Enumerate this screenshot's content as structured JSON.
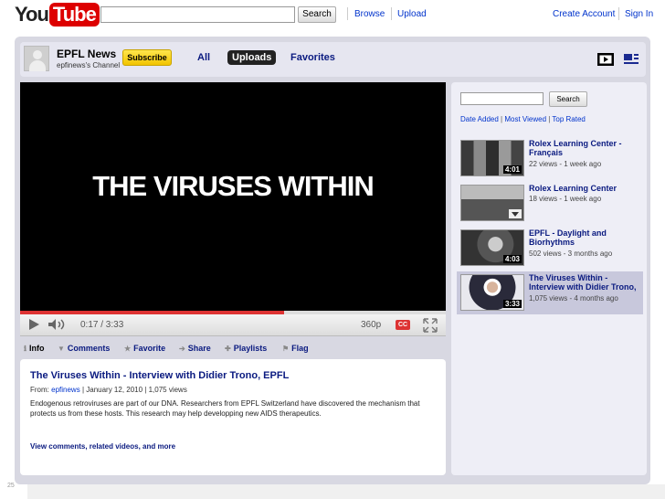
{
  "colors": {
    "brand_red": "#dd0000",
    "link_blue": "#0033cc",
    "subscribe_yellow": "#f2c400",
    "frame_gray": "#d8d8e2"
  },
  "header": {
    "logo_you": "You",
    "logo_tube": "Tube",
    "search_button": "Search",
    "links": {
      "browse": "Browse",
      "upload": "Upload",
      "create_account": "Create Account",
      "sign_in": "Sign In"
    }
  },
  "channel": {
    "name": "EPFL News",
    "subtitle": "epfinews's Channel",
    "subscribe": "Subscribe",
    "tabs": {
      "all": "All",
      "uploads": "Uploads",
      "favorites": "Favorites"
    }
  },
  "player": {
    "title_overlay": "THE VIRUSES WITHIN",
    "time": "0:17 / 3:33",
    "quality": "360p",
    "cc_label": "CC",
    "progress_fraction": 0.62
  },
  "actions": {
    "info": "Info",
    "comments": "Comments",
    "favorite": "Favorite",
    "share": "Share",
    "playlists": "Playlists",
    "flag": "Flag"
  },
  "info": {
    "title": "The Viruses Within - Interview with Didier Trono, EPFL",
    "from_label": "From:",
    "from_user": "epfinews",
    "date": "| January 12, 2010 | 1,075 views",
    "description": "Endogenous retroviruses are part of our DNA. Researchers from EPFL Switzerland have discovered the mechanism that protects us from these hosts. This research may help developping new AIDS therapeutics.",
    "more_link": "View comments, related videos, and more"
  },
  "sidebar": {
    "search_button": "Search",
    "sort": {
      "date_added": "Date Added",
      "most_viewed": "Most Viewed",
      "top_rated": "Top Rated"
    },
    "videos": [
      {
        "title": "Rolex Learning Center - Français",
        "meta": "22 views - 1 week ago",
        "duration": "4:01"
      },
      {
        "title": "Rolex Learning Center",
        "meta": "18 views - 1 week ago",
        "duration": ""
      },
      {
        "title": "EPFL - Daylight and Biorhythms",
        "meta": "502 views - 3 months ago",
        "duration": "4:03"
      },
      {
        "title": "The Viruses Within - Interview with Didier Trono,",
        "meta": "1,075 views - 4 months ago",
        "duration": "3:33"
      }
    ]
  },
  "page_number": "25"
}
